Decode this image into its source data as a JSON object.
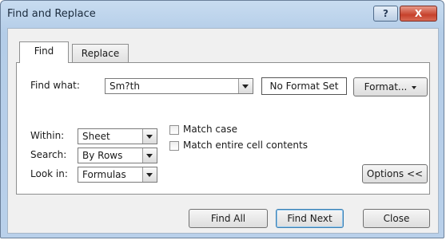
{
  "window": {
    "title": "Find and Replace",
    "help_label": "?",
    "close_label": "X"
  },
  "tabs": {
    "find": "Find",
    "replace": "Replace"
  },
  "find": {
    "label": "Find what:",
    "value": "Sm?th",
    "format_status": "No Format Set",
    "format_button": "Format..."
  },
  "options": {
    "within": {
      "label": "Within:",
      "value": "Sheet"
    },
    "search": {
      "label": "Search:",
      "value": "By Rows"
    },
    "lookin": {
      "label": "Look in:",
      "value": "Formulas"
    },
    "match_case": {
      "label": "Match case",
      "checked": false
    },
    "match_entire": {
      "label": "Match entire cell contents",
      "checked": false
    },
    "options_button": "Options <<"
  },
  "buttons": {
    "find_all": "Find All",
    "find_next": "Find Next",
    "close": "Close"
  }
}
